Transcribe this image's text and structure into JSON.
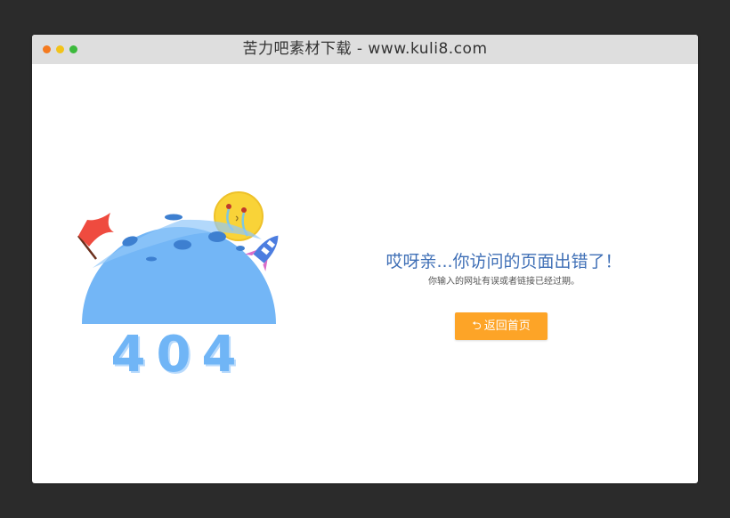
{
  "window": {
    "title": "苦力吧素材下载 - www.kuli8.com",
    "controls": [
      "close",
      "minimize",
      "maximize"
    ]
  },
  "error_page": {
    "code": "404",
    "headline": "哎呀亲...你访问的页面出错了！",
    "description": "你输入的网址有误或者链接已经过期。",
    "home_button": {
      "icon": "return-arrow-icon",
      "label": "返回首页"
    }
  },
  "colors": {
    "page_bg": "#2b2b2b",
    "titlebar_bg": "#dedede",
    "planet_blue": "#73b6f6",
    "headline_blue": "#3f6fb6",
    "button_orange": "#fda427",
    "flag_red": "#ef4b3f",
    "sun_yellow": "#f9d338"
  }
}
